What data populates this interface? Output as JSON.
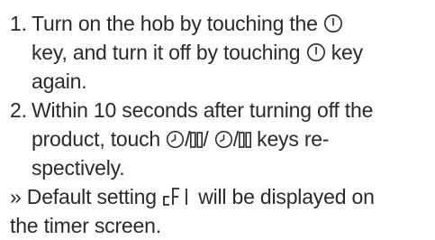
{
  "instructions": {
    "steps": [
      {
        "number": "1.",
        "text_a": "Turn on the hob by touching the ",
        "text_b": "key, and turn it off by touching ",
        "text_c": " key",
        "text_d": "again."
      },
      {
        "number": "2.",
        "text_a": "Within 10 seconds after turning off the",
        "text_b": "product, touch ",
        "separator_1": "/",
        "separator_2": "/ ",
        "separator_3": "/",
        "text_c": " keys re-",
        "text_d": "spectively."
      }
    ],
    "note": {
      "marker": "»",
      "text_a": " Default setting ",
      "display_code": "cFl",
      "text_b": " will be displayed on",
      "text_c": "the timer screen."
    },
    "icons": {
      "power": "power-key-icon",
      "timer": "timer-clock-icon",
      "pause": "pause-key-icon",
      "display_code": "seven-segment-cfl-icon"
    }
  }
}
